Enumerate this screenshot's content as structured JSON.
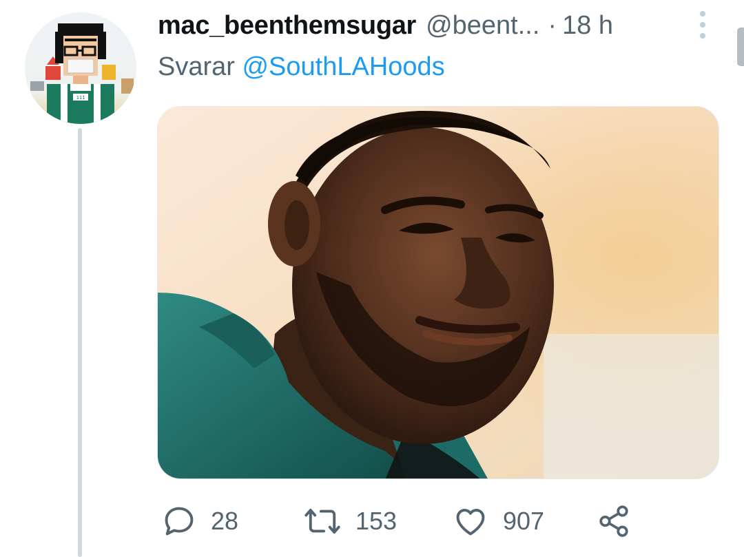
{
  "tweet": {
    "display_name": "mac_beenthemsugar",
    "handle": "@beent...",
    "separator": "·",
    "time": "18 h",
    "reply_prefix": "Svarar",
    "reply_to": "@SouthLAHoods",
    "avatar_icon": "pixel-art-avatar",
    "media_icon": "photo-of-smiling-man",
    "actions": {
      "reply_count": "28",
      "retweet_count": "153",
      "like_count": "907"
    }
  },
  "colors": {
    "text": "#0f1419",
    "secondary": "#536471",
    "link": "#1d9bf0",
    "thread_line": "#cfd9de"
  }
}
